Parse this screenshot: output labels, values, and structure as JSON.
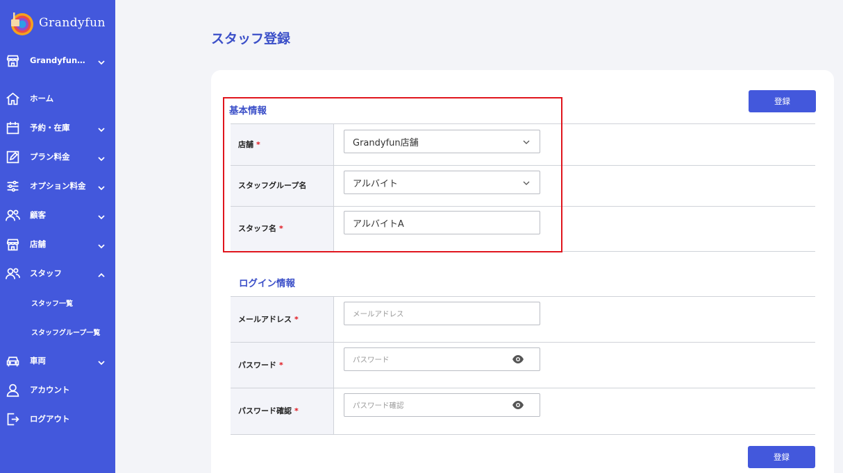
{
  "app": {
    "logo_text": "Grandyfun"
  },
  "colors": {
    "sidebar": "#4358dc",
    "accent": "#3b4fc8",
    "required": "#e0141c",
    "highlight_border": "#e0141c"
  },
  "sidebar": {
    "store_selector": "Grandyfun…",
    "items": [
      {
        "label": "ホーム",
        "icon": "home-icon"
      },
      {
        "label": "予約・在庫",
        "icon": "calendar-icon"
      },
      {
        "label": "プラン料金",
        "icon": "edit-icon"
      },
      {
        "label": "オプション料金",
        "icon": "sliders-icon"
      },
      {
        "label": "顧客",
        "icon": "users-icon"
      },
      {
        "label": "店舗",
        "icon": "store-icon"
      },
      {
        "label": "スタッフ",
        "icon": "staff-icon"
      },
      {
        "label": "車両",
        "icon": "car-icon"
      },
      {
        "label": "アカウント",
        "icon": "user-icon"
      },
      {
        "label": "ログアウト",
        "icon": "logout-icon"
      }
    ],
    "staff_sub": [
      "スタッフ一覧",
      "スタッフグループ一覧"
    ]
  },
  "page": {
    "title": "スタッフ登録"
  },
  "buttons": {
    "register_top": "登録",
    "register_bottom": "登録"
  },
  "basic": {
    "title": "基本情報",
    "store": {
      "label": "店舗",
      "required": "*",
      "value": "Grandyfun店舗"
    },
    "group": {
      "label": "スタッフグループ名",
      "value": "アルバイト"
    },
    "name": {
      "label": "スタッフ名",
      "required": "*",
      "value": "アルバイトA"
    }
  },
  "login": {
    "title": "ログイン情報",
    "email": {
      "label": "メールアドレス",
      "required": "*",
      "placeholder": "メールアドレス"
    },
    "password": {
      "label": "パスワード",
      "required": "*",
      "placeholder": "パスワード"
    },
    "password_confirm": {
      "label": "パスワード確認",
      "required": "*",
      "placeholder": "パスワード確認"
    }
  }
}
